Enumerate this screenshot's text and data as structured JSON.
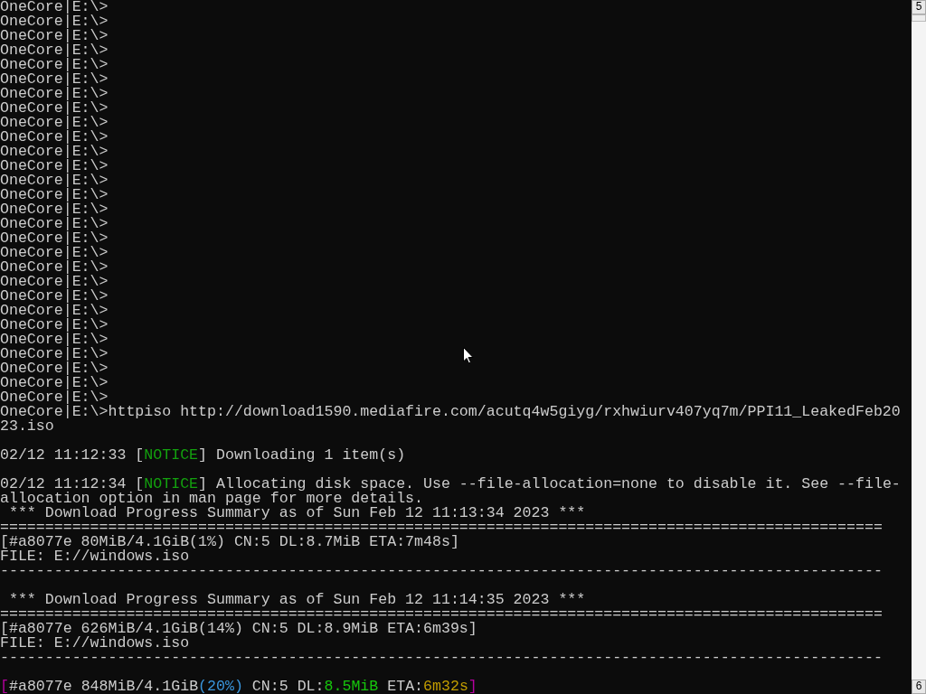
{
  "terminal": {
    "lines": [
      {
        "kind": "text",
        "segments": [
          {
            "text": "OneCore|E:\\>"
          }
        ]
      },
      {
        "kind": "text",
        "segments": [
          {
            "text": "OneCore|E:\\>"
          }
        ]
      },
      {
        "kind": "text",
        "segments": [
          {
            "text": "OneCore|E:\\>"
          }
        ]
      },
      {
        "kind": "text",
        "segments": [
          {
            "text": "OneCore|E:\\>"
          }
        ]
      },
      {
        "kind": "text",
        "segments": [
          {
            "text": "OneCore|E:\\>"
          }
        ]
      },
      {
        "kind": "text",
        "segments": [
          {
            "text": "OneCore|E:\\>"
          }
        ]
      },
      {
        "kind": "text",
        "segments": [
          {
            "text": "OneCore|E:\\>"
          }
        ]
      },
      {
        "kind": "text",
        "segments": [
          {
            "text": "OneCore|E:\\>"
          }
        ]
      },
      {
        "kind": "text",
        "segments": [
          {
            "text": "OneCore|E:\\>"
          }
        ]
      },
      {
        "kind": "text",
        "segments": [
          {
            "text": "OneCore|E:\\>"
          }
        ]
      },
      {
        "kind": "text",
        "segments": [
          {
            "text": "OneCore|E:\\>"
          }
        ]
      },
      {
        "kind": "text",
        "segments": [
          {
            "text": "OneCore|E:\\>"
          }
        ]
      },
      {
        "kind": "text",
        "segments": [
          {
            "text": "OneCore|E:\\>"
          }
        ]
      },
      {
        "kind": "text",
        "segments": [
          {
            "text": "OneCore|E:\\>"
          }
        ]
      },
      {
        "kind": "text",
        "segments": [
          {
            "text": "OneCore|E:\\>"
          }
        ]
      },
      {
        "kind": "text",
        "segments": [
          {
            "text": "OneCore|E:\\>"
          }
        ]
      },
      {
        "kind": "text",
        "segments": [
          {
            "text": "OneCore|E:\\>"
          }
        ]
      },
      {
        "kind": "text",
        "segments": [
          {
            "text": "OneCore|E:\\>"
          }
        ]
      },
      {
        "kind": "text",
        "segments": [
          {
            "text": "OneCore|E:\\>"
          }
        ]
      },
      {
        "kind": "text",
        "segments": [
          {
            "text": "OneCore|E:\\>"
          }
        ]
      },
      {
        "kind": "text",
        "segments": [
          {
            "text": "OneCore|E:\\>"
          }
        ]
      },
      {
        "kind": "text",
        "segments": [
          {
            "text": "OneCore|E:\\>"
          }
        ]
      },
      {
        "kind": "text",
        "segments": [
          {
            "text": "OneCore|E:\\>"
          }
        ]
      },
      {
        "kind": "text",
        "segments": [
          {
            "text": "OneCore|E:\\>"
          }
        ]
      },
      {
        "kind": "text",
        "segments": [
          {
            "text": "OneCore|E:\\>"
          }
        ]
      },
      {
        "kind": "text",
        "segments": [
          {
            "text": "OneCore|E:\\>"
          }
        ]
      },
      {
        "kind": "text",
        "segments": [
          {
            "text": "OneCore|E:\\>"
          }
        ]
      },
      {
        "kind": "text",
        "segments": [
          {
            "text": "OneCore|E:\\>"
          }
        ]
      },
      {
        "kind": "text",
        "segments": [
          {
            "text": "OneCore|E:\\>httpiso http://download1590.mediafire.com/acutq4w5giyg/rxhwiurv407yq7m/PPI11_LeakedFeb20"
          }
        ]
      },
      {
        "kind": "text",
        "segments": [
          {
            "text": "23.iso"
          }
        ]
      },
      {
        "kind": "blank"
      },
      {
        "kind": "text",
        "segments": [
          {
            "text": "02/12 11:12:33 ["
          },
          {
            "text": "NOTICE",
            "color": "#13a10e"
          },
          {
            "text": "] Downloading 1 item(s)"
          }
        ]
      },
      {
        "kind": "blank"
      },
      {
        "kind": "text",
        "segments": [
          {
            "text": "02/12 11:12:34 ["
          },
          {
            "text": "NOTICE",
            "color": "#13a10e"
          },
          {
            "text": "] Allocating disk space. Use --file-allocation=none to disable it. See --file-"
          }
        ]
      },
      {
        "kind": "text",
        "segments": [
          {
            "text": "allocation option in man page for more details."
          }
        ]
      },
      {
        "kind": "text",
        "segments": [
          {
            "text": " *** Download Progress Summary as of Sun Feb 12 11:13:34 2023 ***"
          }
        ]
      },
      {
        "kind": "text",
        "segments": [
          {
            "text": "=================================================================================================="
          }
        ]
      },
      {
        "kind": "text",
        "segments": [
          {
            "text": "[#a8077e 80MiB/4.1GiB(1%) CN:5 DL:8.7MiB ETA:7m48s]"
          }
        ]
      },
      {
        "kind": "text",
        "segments": [
          {
            "text": "FILE: E://windows.iso"
          }
        ]
      },
      {
        "kind": "text",
        "segments": [
          {
            "text": "--------------------------------------------------------------------------------------------------"
          }
        ]
      },
      {
        "kind": "blank"
      },
      {
        "kind": "text",
        "segments": [
          {
            "text": " *** Download Progress Summary as of Sun Feb 12 11:14:35 2023 ***"
          }
        ]
      },
      {
        "kind": "text",
        "segments": [
          {
            "text": "=================================================================================================="
          }
        ]
      },
      {
        "kind": "text",
        "segments": [
          {
            "text": "[#a8077e 626MiB/4.1GiB(14%) CN:5 DL:8.9MiB ETA:6m39s]"
          }
        ]
      },
      {
        "kind": "text",
        "segments": [
          {
            "text": "FILE: E://windows.iso"
          }
        ]
      },
      {
        "kind": "text",
        "segments": [
          {
            "text": "--------------------------------------------------------------------------------------------------"
          }
        ]
      },
      {
        "kind": "blank"
      },
      {
        "kind": "text",
        "segments": [
          {
            "text": "[",
            "color": "#b4009e"
          },
          {
            "text": "#a8077e 848MiB/4.1GiB"
          },
          {
            "text": "(20%)",
            "color": "#3a96dd"
          },
          {
            "text": " CN:5 DL:"
          },
          {
            "text": "8.5MiB",
            "color": "#16c60c"
          },
          {
            "text": " ETA:"
          },
          {
            "text": "6m32s",
            "color": "#c19c00"
          },
          {
            "text": "]",
            "color": "#b4009e"
          }
        ]
      }
    ]
  },
  "scrollbar": {
    "top_label": "5",
    "bottom_label": "6"
  }
}
